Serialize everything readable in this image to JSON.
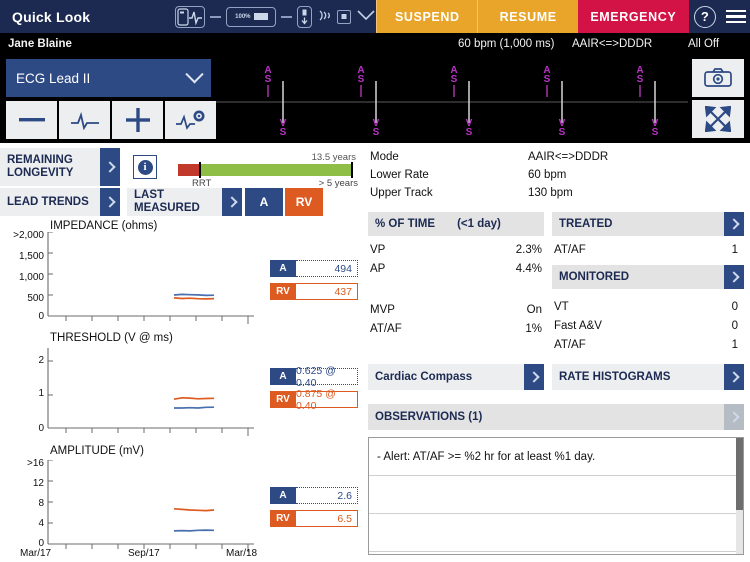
{
  "header": {
    "title": "Quick Look",
    "icons": [
      "device-telemetry-icon",
      "battery-icon",
      "lead-icon",
      "wireless-icon",
      "session-icon",
      "chevron-down-icon"
    ],
    "battery_level": "100%",
    "suspend_label": "SUSPEND",
    "resume_label": "RESUME",
    "emergency_label": "EMERGENCY",
    "help_label": "?",
    "colors": {
      "suspend": "#e9a52a",
      "resume": "#e9a52a",
      "emergency": "#d31245",
      "navy": "#1c2a52"
    }
  },
  "patient_bar": {
    "name": "Jane Blaine",
    "rate": "60 bpm (1,000 ms)",
    "mode": "AAIR<=>DDDR",
    "alerts": "All Off"
  },
  "ecg": {
    "lead_label": "ECG Lead II",
    "controls": [
      "minus-button",
      "waveform-button",
      "plus-button",
      "waveform-settings-button"
    ],
    "minus_label": "—",
    "plus_label": "+",
    "side_buttons": [
      "camera-icon",
      "expand-icon"
    ],
    "markers_top": "AS",
    "markers_bottom": "VS",
    "marker_count": 5
  },
  "left_rows": {
    "remaining_longevity": "REMAINING\nLONGEVITY",
    "remaining_longevity_l1": "REMAINING",
    "remaining_longevity_l2": "LONGEVITY",
    "info_glyph": "i",
    "longevity_value": "13.5 years",
    "longevity_rrt": "RRT",
    "longevity_min": "> 5 years",
    "lead_trends": "LEAD TRENDS",
    "last_measured_l1": "LAST",
    "last_measured_l2": "MEASURED",
    "chip_a": "A",
    "chip_rv": "RV"
  },
  "charts": [
    {
      "type": "line",
      "title": "IMPEDANCE (ohms)",
      "ylabel": "",
      "ytick_labels": [
        ">2,000",
        "1,500",
        "1,000",
        "500",
        "0"
      ],
      "ylim": [
        0,
        2000
      ],
      "xticks": [
        "Mar/17",
        "Sep/17",
        "Mar/18"
      ],
      "series": [
        {
          "name": "A",
          "color": "#4a6fae",
          "values": [
            520,
            530,
            525,
            522,
            515,
            518
          ]
        },
        {
          "name": "RV",
          "color": "#dd5b21",
          "values": [
            455,
            440,
            448,
            435,
            432,
            437
          ]
        }
      ],
      "value_a": "494",
      "value_rv": "437"
    },
    {
      "type": "line",
      "title": "THRESHOLD (V @ ms)",
      "ytick_labels": [
        "2",
        "1",
        "0"
      ],
      "ylim": [
        0,
        2.4
      ],
      "xticks": [
        "Mar/17",
        "Sep/17",
        "Mar/18"
      ],
      "series": [
        {
          "name": "A",
          "color": "#4a6fae",
          "values": [
            0.6,
            0.6,
            0.61,
            0.6,
            0.62,
            0.625
          ]
        },
        {
          "name": "RV",
          "color": "#dd5b21",
          "values": [
            0.85,
            0.89,
            0.88,
            0.86,
            0.87,
            0.875
          ]
        }
      ],
      "value_a": "0.625 @ 0.40",
      "value_rv": "0.875 @ 0.40"
    },
    {
      "type": "line",
      "title": "AMPLITUDE (mV)",
      "ytick_labels": [
        ">16",
        "12",
        "8",
        "4",
        "0"
      ],
      "ylim": [
        0,
        16
      ],
      "xticks": [
        "Mar/17",
        "Sep/17",
        "Mar/18"
      ],
      "series": [
        {
          "name": "A",
          "color": "#4a6fae",
          "values": [
            2.5,
            2.55,
            2.5,
            2.6,
            2.65,
            2.6
          ]
        },
        {
          "name": "RV",
          "color": "#dd5b21",
          "values": [
            6.7,
            6.6,
            6.5,
            6.45,
            6.4,
            6.5
          ]
        }
      ],
      "value_a": "2.6",
      "value_rv": "6.5"
    }
  ],
  "chart_data": {
    "type": "line",
    "title": "Lead Trends",
    "panels": [
      {
        "title": "IMPEDANCE (ohms)",
        "ylabel": "ohms",
        "ylim": [
          0,
          2000
        ],
        "yticks": [
          0,
          500,
          1000,
          1500,
          2000
        ],
        "ytick_labels": [
          "0",
          "500",
          "1,000",
          "1,500",
          ">2,000"
        ],
        "xlabel": "",
        "x": [
          "Dec/17",
          "Jan/18",
          "Jan/18",
          "Feb/18",
          "Feb/18",
          "Mar/18"
        ],
        "xlim": [
          "Mar/17",
          "Mar/18"
        ],
        "xtick_labels": [
          "Mar/17",
          "Sep/17",
          "Mar/18"
        ],
        "grid": false,
        "series": [
          {
            "name": "A",
            "color": "#4a6fae",
            "values": [
              520,
              530,
              525,
              522,
              515,
              518
            ],
            "latest": 494
          },
          {
            "name": "RV",
            "color": "#dd5b21",
            "values": [
              455,
              440,
              448,
              435,
              432,
              437
            ],
            "latest": 437
          }
        ]
      },
      {
        "title": "THRESHOLD (V @ ms)",
        "ylabel": "V",
        "ylim": [
          0,
          2.4
        ],
        "yticks": [
          0,
          1,
          2
        ],
        "ytick_labels": [
          "0",
          "1",
          "2"
        ],
        "xlabel": "",
        "x": [
          "Dec/17",
          "Jan/18",
          "Jan/18",
          "Feb/18",
          "Feb/18",
          "Mar/18"
        ],
        "xtick_labels": [
          "Mar/17",
          "Sep/17",
          "Mar/18"
        ],
        "grid": false,
        "series": [
          {
            "name": "A",
            "color": "#4a6fae",
            "values": [
              0.6,
              0.6,
              0.61,
              0.6,
              0.62,
              0.625
            ],
            "latest": "0.625 @ 0.40"
          },
          {
            "name": "RV",
            "color": "#dd5b21",
            "values": [
              0.85,
              0.89,
              0.88,
              0.86,
              0.87,
              0.875
            ],
            "latest": "0.875 @ 0.40"
          }
        ]
      },
      {
        "title": "AMPLITUDE (mV)",
        "ylabel": "mV",
        "ylim": [
          0,
          16
        ],
        "yticks": [
          0,
          4,
          8,
          12,
          16
        ],
        "ytick_labels": [
          "0",
          "4",
          "8",
          "12",
          ">16"
        ],
        "xlabel": "",
        "x": [
          "Dec/17",
          "Jan/18",
          "Jan/18",
          "Feb/18",
          "Feb/18",
          "Mar/18"
        ],
        "xtick_labels": [
          "Mar/17",
          "Sep/17",
          "Mar/18"
        ],
        "grid": false,
        "series": [
          {
            "name": "A",
            "color": "#4a6fae",
            "values": [
              2.5,
              2.55,
              2.5,
              2.6,
              2.65,
              2.6
            ],
            "latest": 2.6
          },
          {
            "name": "RV",
            "color": "#dd5b21",
            "values": [
              6.7,
              6.6,
              6.5,
              6.45,
              6.4,
              6.5
            ],
            "latest": 6.5
          }
        ]
      }
    ],
    "legend": [
      "A",
      "RV"
    ],
    "legend_position": "right-inline"
  },
  "params": {
    "mode_label": "Mode",
    "mode_value": "AAIR<=>DDDR",
    "lower_label": "Lower Rate",
    "lower_value": "60 bpm",
    "upper_label": "Upper Track",
    "upper_value": "130 bpm"
  },
  "pct_of_time": {
    "header": "% OF TIME",
    "header_period": "(<1 day)",
    "rows": [
      {
        "label": "VP",
        "value": "2.3%"
      },
      {
        "label": "AP",
        "value": "4.4%"
      },
      {
        "label": "",
        "value": ""
      },
      {
        "label": "MVP",
        "value": "On"
      },
      {
        "label": "AT/AF",
        "value": "1%"
      }
    ]
  },
  "episodes": {
    "treated_header": "TREATED",
    "treated_rows": [
      {
        "label": "AT/AF",
        "value": "1"
      }
    ],
    "monitored_header": "MONITORED",
    "monitored_rows": [
      {
        "label": "VT",
        "value": "0"
      },
      {
        "label": "Fast A&V",
        "value": "0"
      },
      {
        "label": "AT/AF",
        "value": "1"
      }
    ]
  },
  "nav": {
    "cardiac_compass": "Cardiac Compass",
    "rate_histograms": "RATE HISTOGRAMS",
    "observations": "OBSERVATIONS (1)"
  },
  "observations": {
    "rows": [
      "- Alert: AT/AF >= %2 hr for at least %1 day.",
      "",
      ""
    ]
  }
}
